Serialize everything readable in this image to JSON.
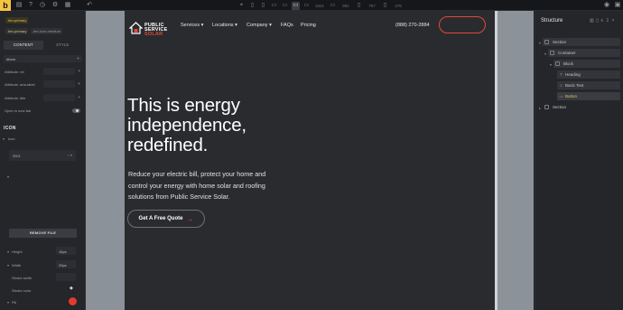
{
  "toolbar": {
    "logo": "b",
    "icons": [
      "file-icon",
      "help-icon",
      "history-icon",
      "settings-icon",
      "layers-icon",
      "undo-icon",
      "redo-icon"
    ],
    "devices": [
      "cursor-icon",
      "tablet-icon",
      "phone-icon",
      "desktop-icon",
      "desktop-wide-icon",
      "monitor-icon"
    ],
    "widths": [
      "1021",
      "991",
      "767",
      "478"
    ],
    "right_icons": [
      "preview-icon",
      "save-icon"
    ]
  },
  "left_panel": {
    "class_primary": ".btn-primary",
    "class_a": ".btn-primary",
    "class_b": ".btn-icon-medium",
    "tab_content": "CONTENT",
    "tab_style": "STYLE",
    "link_value": "#form",
    "attr_rel": "Attribute: rel",
    "attr_aria": "Attribute: aria-label",
    "attr_title": "Attribute: title",
    "open_new_tab": "Open in new tab",
    "icon_section": "ICON",
    "icon_label": "Icon",
    "svg_value": "SVG",
    "remove_file": "REMOVE FILE",
    "height_label": "Height",
    "height_value": "16px",
    "width_label": "Width",
    "width_value": "20px",
    "stroke_width": "Stroke width",
    "stroke_color": "Stroke color",
    "fill_label": "Fill",
    "fill_color": "#e23b2f"
  },
  "site": {
    "brand_line1": "PUBLIC",
    "brand_line2": "SERVICE",
    "brand_line3": "SOLAR",
    "nav": [
      "Services",
      "Locations",
      "Company",
      "FAQs",
      "Pricing"
    ],
    "phone": "(888) 270-2884",
    "hero_title": "This is energy independence, redefined.",
    "hero_sub": "Reduce your electric bill, protect your home and control your energy with home solar and roofing solutions from Public Service Solar.",
    "cta": "Get A Free Quote",
    "accent": "#e04a3a"
  },
  "structure": {
    "title": "Structure",
    "nodes": [
      {
        "label": "Section"
      },
      {
        "label": "Container"
      },
      {
        "label": "Block"
      },
      {
        "label": "Heading"
      },
      {
        "label": "Basic Text"
      },
      {
        "label": "Button"
      },
      {
        "label": "Section"
      }
    ]
  }
}
